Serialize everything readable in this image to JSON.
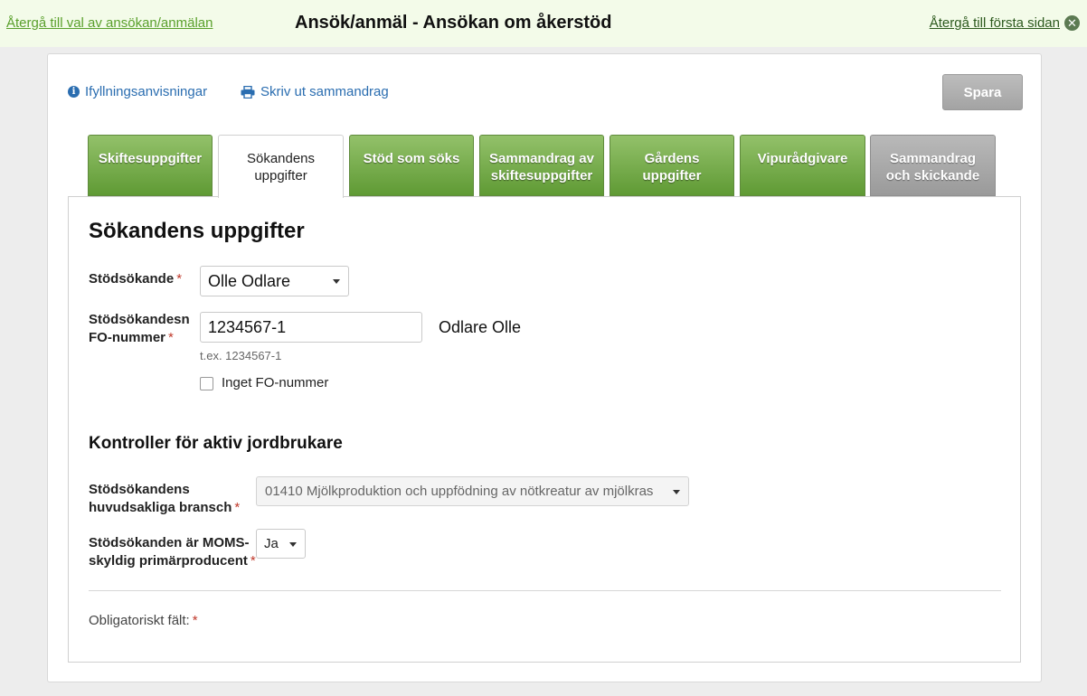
{
  "topbar": {
    "back_link": "Återgå till val av ansökan/anmälan",
    "title": "Ansök/anmäl - Ansökan om åkerstöd",
    "home_link": "Återgå till första sidan",
    "home_icon": "close-icon"
  },
  "toolbar": {
    "instructions_label": "Ifyllningsanvisningar",
    "print_label": "Skriv ut sammandrag",
    "save_label": "Spara"
  },
  "tabs": [
    {
      "line1": "Skiftesuppgifter",
      "line2": "",
      "state": "green"
    },
    {
      "line1": "Sökandens",
      "line2": "uppgifter",
      "state": "active"
    },
    {
      "line1": "Stöd som söks",
      "line2": "",
      "state": "green"
    },
    {
      "line1": "Sammandrag av",
      "line2": "skiftesuppgifter",
      "state": "green"
    },
    {
      "line1": "Gårdens",
      "line2": "uppgifter",
      "state": "green"
    },
    {
      "line1": "Vipurådgivare",
      "line2": "",
      "state": "green"
    },
    {
      "line1": "Sammandrag",
      "line2": "och skickande",
      "state": "grey"
    }
  ],
  "form": {
    "heading": "Sökandens uppgifter",
    "applicant_label": "Stödsökande",
    "applicant_value": "Olle Odlare",
    "fo_label_line1": "Stödsökandesn",
    "fo_label_line2": "FO-nummer",
    "fo_value": "1234567-1",
    "fo_name": "Odlare Olle",
    "fo_hint": "t.ex. 1234567-1",
    "no_fo_label": "Inget FO-nummer",
    "no_fo_checked": false,
    "section2_heading": "Kontroller för aktiv jordbrukare",
    "branch_label_line1": "Stödsökandens",
    "branch_label_line2": "huvudsakliga bransch",
    "branch_value": "01410 Mjölkproduktion och uppfödning av nötkreatur av mjölkras",
    "vat_label_line1": "Stödsökanden är MOMS-",
    "vat_label_line2": "skyldig primärproducent",
    "vat_value": "Ja",
    "required_mark": "*",
    "mandatory_note": "Obligatoriskt fält:"
  }
}
